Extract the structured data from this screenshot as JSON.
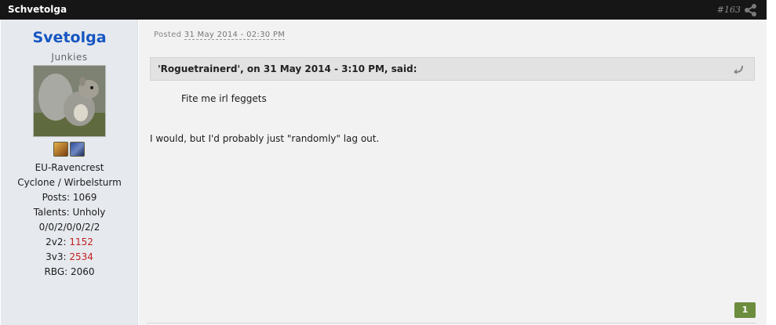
{
  "header": {
    "author_name": "Schvetolga",
    "post_number": "#163",
    "share_icon": "share-icon"
  },
  "author": {
    "username": "Svetolga",
    "group": "Junkies",
    "avatar_icon": "squirrel-avatar",
    "badges": [
      "warrior-badge",
      "shaman-badge"
    ],
    "realm": "EU-Ravencrest",
    "battlegroup": "Cyclone / Wirbelsturm",
    "posts": "Posts: 1069",
    "talents": "Talents: Unholy",
    "talent_build": "0/0/2/0/0/2/2",
    "rating_2v2_label": "2v2: ",
    "rating_2v2_value": "1152",
    "rating_3v3_label": "3v3: ",
    "rating_3v3_value": "2534",
    "rbg": "RBG: 2060"
  },
  "post": {
    "posted_label": "Posted",
    "posted_date": "31 May 2014 - 02:30 PM",
    "quote_citation": "'Roguetrainerd', on 31 May 2014 - 3:10 PM, said:",
    "quote_text": "Fite me irl feggets",
    "reply_text": "I would, but I'd probably just \"randomly\" lag out.",
    "reputation": "1"
  },
  "colors": {
    "header_bg": "#161616",
    "username": "#1656c2",
    "rating_red": "#c21f1f",
    "reputation_bg": "#6d8d3e"
  }
}
